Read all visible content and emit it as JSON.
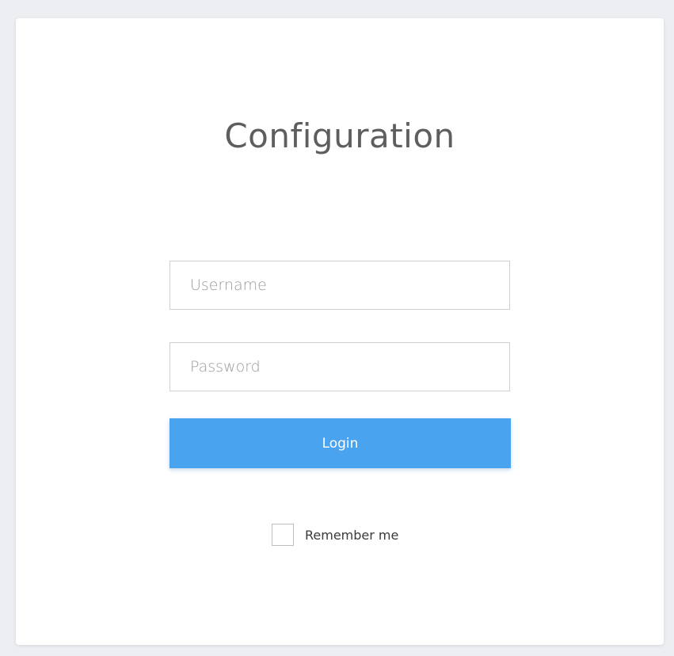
{
  "form": {
    "title": "Configuration",
    "username": {
      "placeholder": "Username",
      "value": ""
    },
    "password": {
      "placeholder": "Password",
      "value": ""
    },
    "login_label": "Login",
    "remember_label": "Remember me",
    "remember_checked": false
  },
  "colors": {
    "background": "#eceef2",
    "card": "#ffffff",
    "accent": "#4aa3ef",
    "title": "#5e5e5e"
  }
}
